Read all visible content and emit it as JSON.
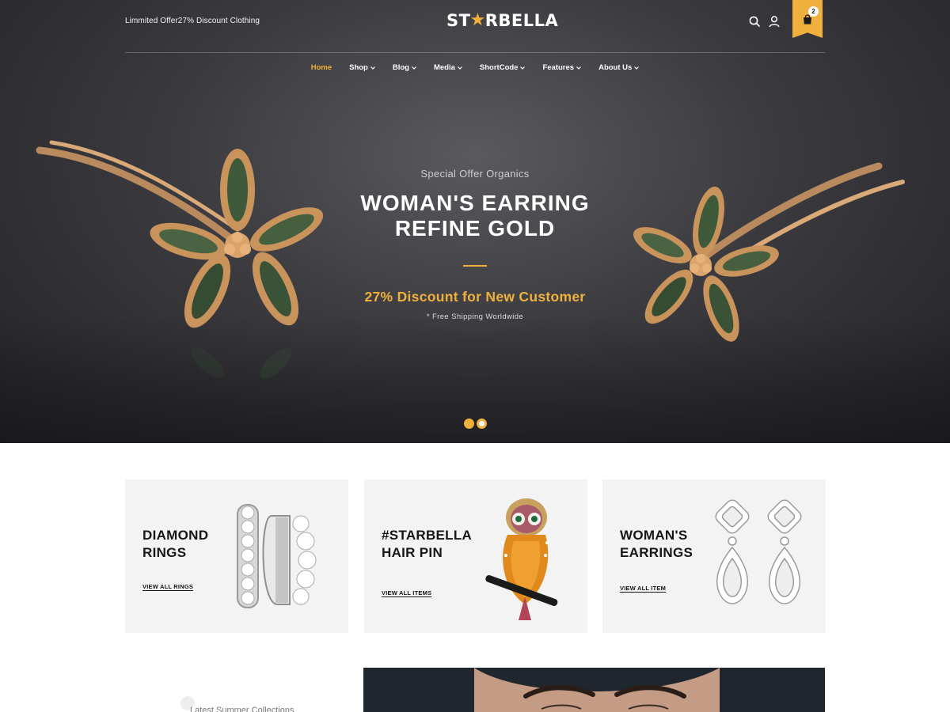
{
  "header": {
    "offer_text": "Limmited Offer27% Discount Clothing",
    "logo_left": "ST",
    "logo_right": "RBELLA",
    "cart_count": "2",
    "icons": [
      "search-icon",
      "user-icon",
      "cart-icon"
    ]
  },
  "nav": {
    "items": [
      {
        "label": "Home",
        "active": true,
        "dropdown": false
      },
      {
        "label": "Shop",
        "dropdown": true
      },
      {
        "label": "Blog",
        "dropdown": true
      },
      {
        "label": "Media",
        "dropdown": true
      },
      {
        "label": "ShortCode",
        "dropdown": true
      },
      {
        "label": "Features",
        "dropdown": true
      },
      {
        "label": "About Us",
        "dropdown": true
      }
    ]
  },
  "hero": {
    "subtitle": "Special Offer Organics",
    "title_line1": "WOMAN'S EARRING",
    "title_line2": "REFINE GOLD",
    "discount": "27% Discount for New Customer",
    "shipping": "* Free Shipping Worldwide",
    "slides": 2,
    "active_slide": 1
  },
  "categories": [
    {
      "title_line1": "DIAMOND",
      "title_line2": "RINGS",
      "link": "VIEW ALL RINGS"
    },
    {
      "title_line1": "#STARBELLA",
      "title_line2": "HAIR PIN",
      "link": "VIEW ALL ITEMS"
    },
    {
      "title_line1": "WOMAN'S",
      "title_line2": "EARRINGS",
      "link": "VIEW ALL ITEM"
    }
  ],
  "summer": {
    "label": "Latest Summer Collections"
  },
  "colors": {
    "accent": "#f0b13c",
    "card_bg": "#f3f3f3",
    "hero_dark": "#3b3b3f"
  }
}
